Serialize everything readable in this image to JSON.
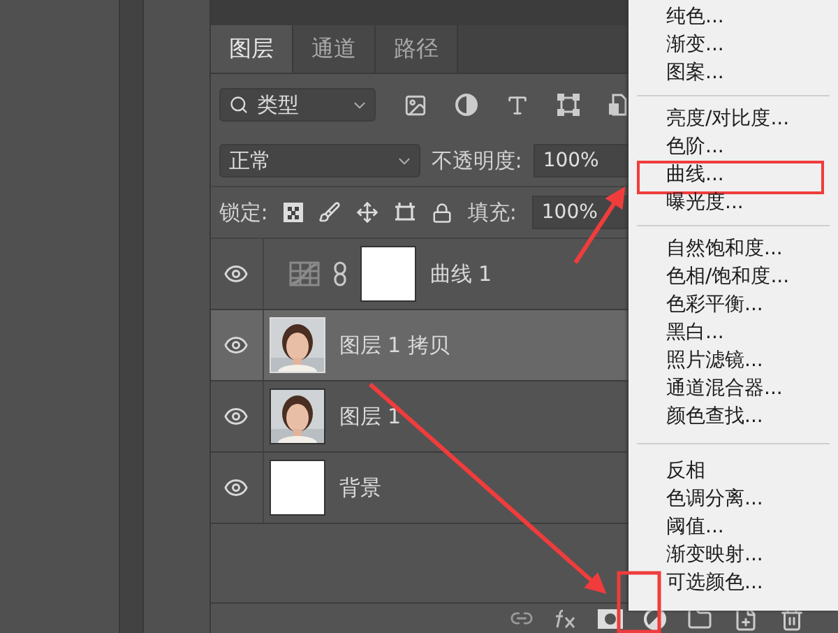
{
  "tabs": [
    {
      "label": "图层",
      "selected": true
    },
    {
      "label": "通道",
      "selected": false
    },
    {
      "label": "路径",
      "selected": false
    }
  ],
  "filter": {
    "value": "类型"
  },
  "blend": {
    "value": "正常",
    "opacity_label": "不透明度:",
    "opacity": "100%"
  },
  "lock": {
    "label": "锁定:",
    "fill_label": "填充:",
    "fill": "100%"
  },
  "layers": [
    {
      "name": "曲线 1",
      "kind": "adjustment",
      "visible": true,
      "selected": false
    },
    {
      "name": "图层 1 拷贝",
      "visible": true,
      "selected": true
    },
    {
      "name": "图层 1",
      "visible": true,
      "selected": false
    },
    {
      "name": "背景",
      "kind": "blank",
      "visible": true,
      "selected": false
    }
  ],
  "menu": {
    "groups": [
      [
        {
          "label": "纯色...",
          "annotated": false
        },
        {
          "label": "渐变...",
          "annotated": false
        },
        {
          "label": "图案...",
          "annotated": false
        }
      ],
      [
        {
          "label": "亮度/对比度...",
          "annotated": false
        },
        {
          "label": "色阶...",
          "annotated": false
        },
        {
          "label": "曲线...",
          "annotated": true
        },
        {
          "label": "曝光度...",
          "annotated": false
        }
      ],
      [
        {
          "label": "自然饱和度...",
          "annotated": false
        },
        {
          "label": "色相/饱和度...",
          "annotated": false
        },
        {
          "label": "色彩平衡...",
          "annotated": false
        },
        {
          "label": "黑白...",
          "annotated": false
        },
        {
          "label": "照片滤镜...",
          "annotated": false
        },
        {
          "label": "通道混合器...",
          "annotated": false
        },
        {
          "label": "颜色查找...",
          "annotated": false
        }
      ],
      [
        {
          "label": "反相",
          "annotated": false
        },
        {
          "label": "色调分离...",
          "annotated": false
        },
        {
          "label": "阈值...",
          "annotated": false
        },
        {
          "label": "渐变映射...",
          "annotated": false
        },
        {
          "label": "可选颜色...",
          "annotated": false
        }
      ]
    ]
  }
}
